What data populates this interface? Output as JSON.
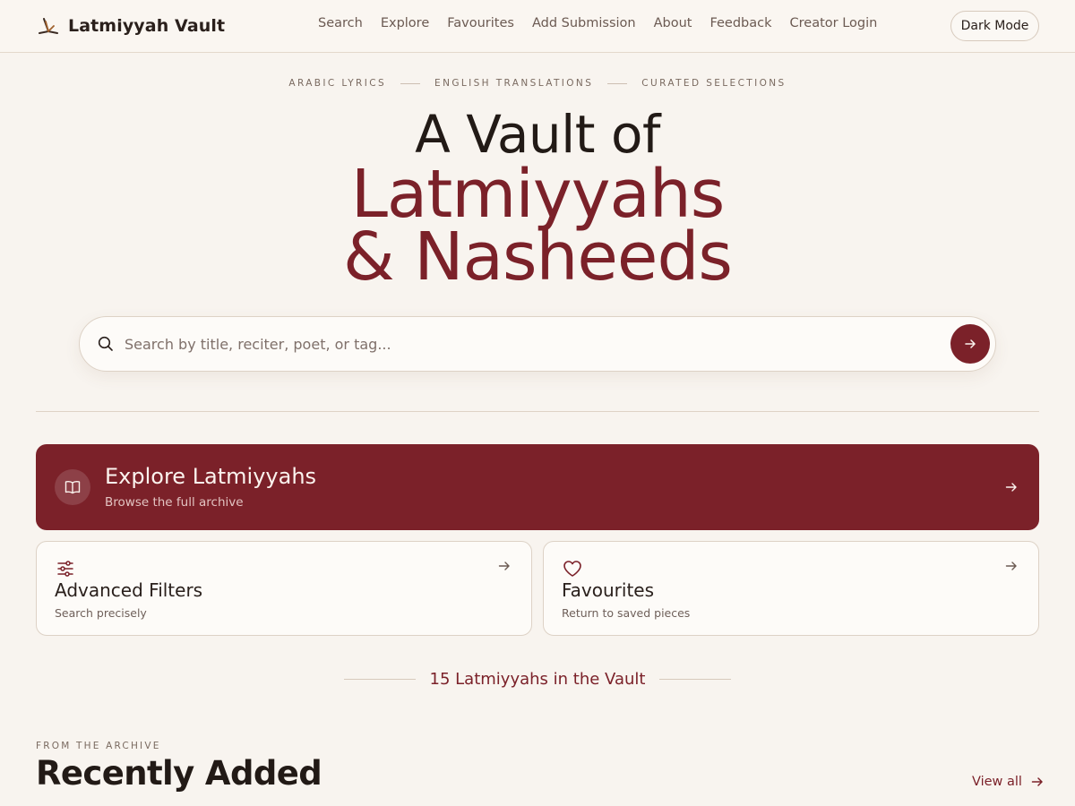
{
  "brand": {
    "name": "Latmiyyah Vault",
    "icon": "book-stand-icon"
  },
  "nav": {
    "items": [
      "Search",
      "Explore",
      "Favourites",
      "Add Submission",
      "About",
      "Feedback",
      "Creator Login"
    ]
  },
  "header": {
    "dark_mode_label": "Dark Mode"
  },
  "hero": {
    "eyebrow": [
      "Arabic Lyrics",
      "English Translations",
      "Curated Selections"
    ],
    "title_line1": "A Vault of",
    "title_line2": "Latmiyyahs",
    "title_line3": "& Nasheeds"
  },
  "search": {
    "placeholder": "Search by title, reciter, poet, or tag...",
    "value": ""
  },
  "explore": {
    "title": "Explore Latmiyyahs",
    "subtitle": "Browse the full archive",
    "icon": "open-book-icon"
  },
  "cards": [
    {
      "title": "Advanced Filters",
      "subtitle": "Search precisely",
      "icon": "sliders-icon"
    },
    {
      "title": "Favourites",
      "subtitle": "Return to saved pieces",
      "icon": "heart-icon"
    }
  ],
  "stats": {
    "count_text": "15 Latmiyyahs in the Vault"
  },
  "recent": {
    "eyebrow": "FROM THE ARCHIVE",
    "title": "Recently Added",
    "view_all": "View all"
  },
  "colors": {
    "accent": "#7b2129",
    "background": "#f8f4ef",
    "card": "#fdfbf8",
    "border": "#ddd2c6"
  }
}
